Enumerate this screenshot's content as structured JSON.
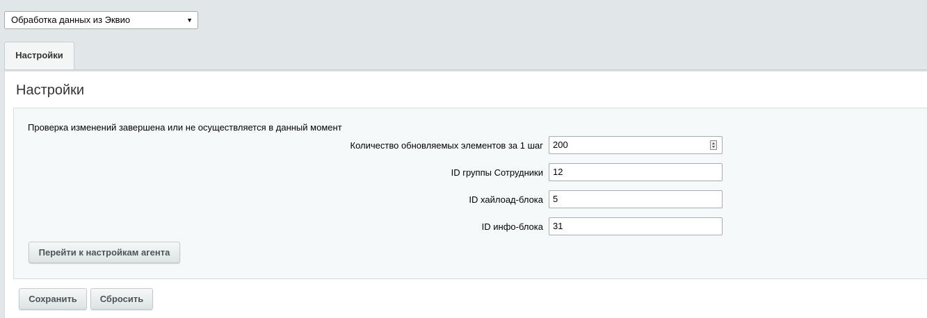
{
  "module_select": {
    "selected": "Обработка данных из Эквио",
    "caret": "▼"
  },
  "tabs": [
    {
      "label": "Настройки",
      "active": true
    }
  ],
  "page": {
    "title": "Настройки",
    "status": "Проверка изменений завершена или не осуществляется в данный момент"
  },
  "fields": [
    {
      "label": "Количество обновляемых элементов за 1 шаг",
      "value": "200",
      "type": "number"
    },
    {
      "label": "ID группы Сотрудники",
      "value": "12",
      "type": "text"
    },
    {
      "label": "ID хайлоад-блока",
      "value": "5",
      "type": "text"
    },
    {
      "label": "ID инфо-блока",
      "value": "31",
      "type": "text"
    }
  ],
  "buttons": {
    "agent_settings": "Перейти к настройкам агента",
    "save": "Сохранить",
    "reset": "Сбросить"
  }
}
